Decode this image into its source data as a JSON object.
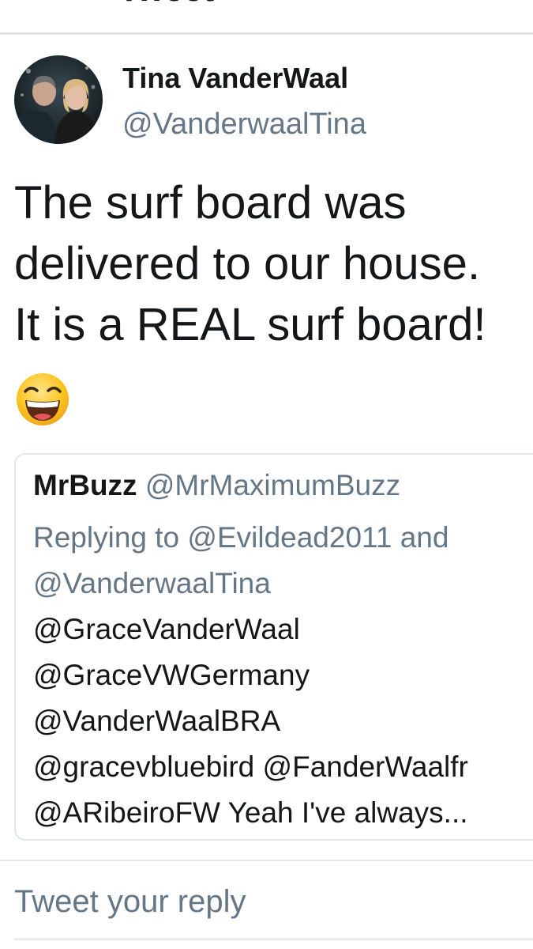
{
  "header": {
    "title": "Tweet"
  },
  "tweet": {
    "author": {
      "name": "Tina VanderWaal",
      "handle": "@VanderwaalTina"
    },
    "text_lines": [
      "The surf board was",
      "delivered to our house.",
      "It is a REAL surf board!"
    ],
    "emoji": "grinning-squinting-face"
  },
  "quoted_tweet": {
    "name": "MrBuzz",
    "handle": "@MrMaximumBuzz",
    "reply_lines": [
      "Replying to @Evildead2011 and",
      "@VanderwaalTina"
    ],
    "body_lines": [
      "@GraceVanderWaal",
      "@GraceVWGermany",
      "@VanderWaalBRA",
      "@gracevbluebird @FanderWaalfr",
      "@ARibeiroFW Yeah I've always..."
    ]
  },
  "reply": {
    "placeholder": "Tweet your reply"
  },
  "colors": {
    "text": "#14171a",
    "secondary": "#657786",
    "border": "#e1e8ed"
  }
}
